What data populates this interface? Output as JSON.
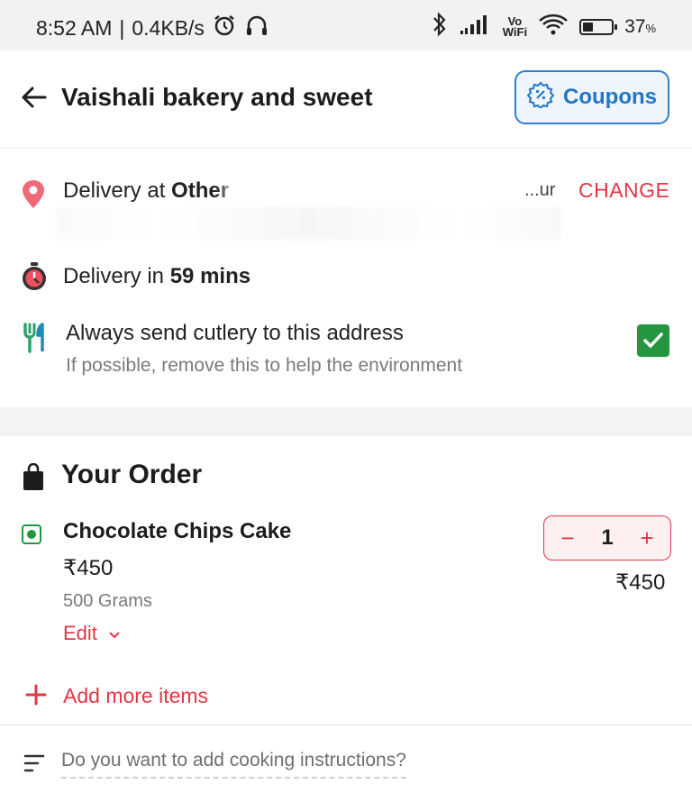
{
  "status_bar": {
    "time": "8:52 AM",
    "separator": "|",
    "speed": "0.4KB/s",
    "vowifi_top": "Vo",
    "vowifi_bottom": "WiFi",
    "battery_percent": "37",
    "battery_unit": "%",
    "battery_level": 0.37
  },
  "header": {
    "title": "Vaishali bakery and sweet",
    "coupons_label": "Coupons",
    "accent_color": "#2376c7"
  },
  "delivery": {
    "prefix": "Delivery at ",
    "location_name": "Other",
    "address_tail": "...ur",
    "change_label": "CHANGE",
    "time_prefix": "Delivery in ",
    "time_value": "59 mins"
  },
  "cutlery": {
    "title": "Always send cutlery to this address",
    "subtitle": "If possible, remove this to help the environment",
    "checked": true
  },
  "order": {
    "title": "Your Order",
    "items": [
      {
        "name": "Chocolate Chips Cake",
        "price": "₹450",
        "weight": "500 Grams",
        "edit_label": "Edit",
        "quantity": "1",
        "minus": "−",
        "plus": "+",
        "total": "₹450",
        "veg": true
      }
    ],
    "add_more_label": "Add more items",
    "instructions_placeholder": "Do you want to add cooking instructions?"
  },
  "colors": {
    "brand_red": "#e23744",
    "veg_green": "#24963f",
    "coupon_blue": "#2376c7"
  },
  "icons": [
    "alarm-icon",
    "headset-icon",
    "bluetooth-icon",
    "signal-icon",
    "wifi-icon",
    "battery-icon",
    "back-arrow-icon",
    "coupon-percent-icon",
    "location-pin-icon",
    "stopwatch-icon",
    "cutlery-icon",
    "checkbox-icon",
    "bag-icon",
    "veg-icon",
    "chevron-down-icon",
    "plus-icon",
    "lines-icon"
  ]
}
